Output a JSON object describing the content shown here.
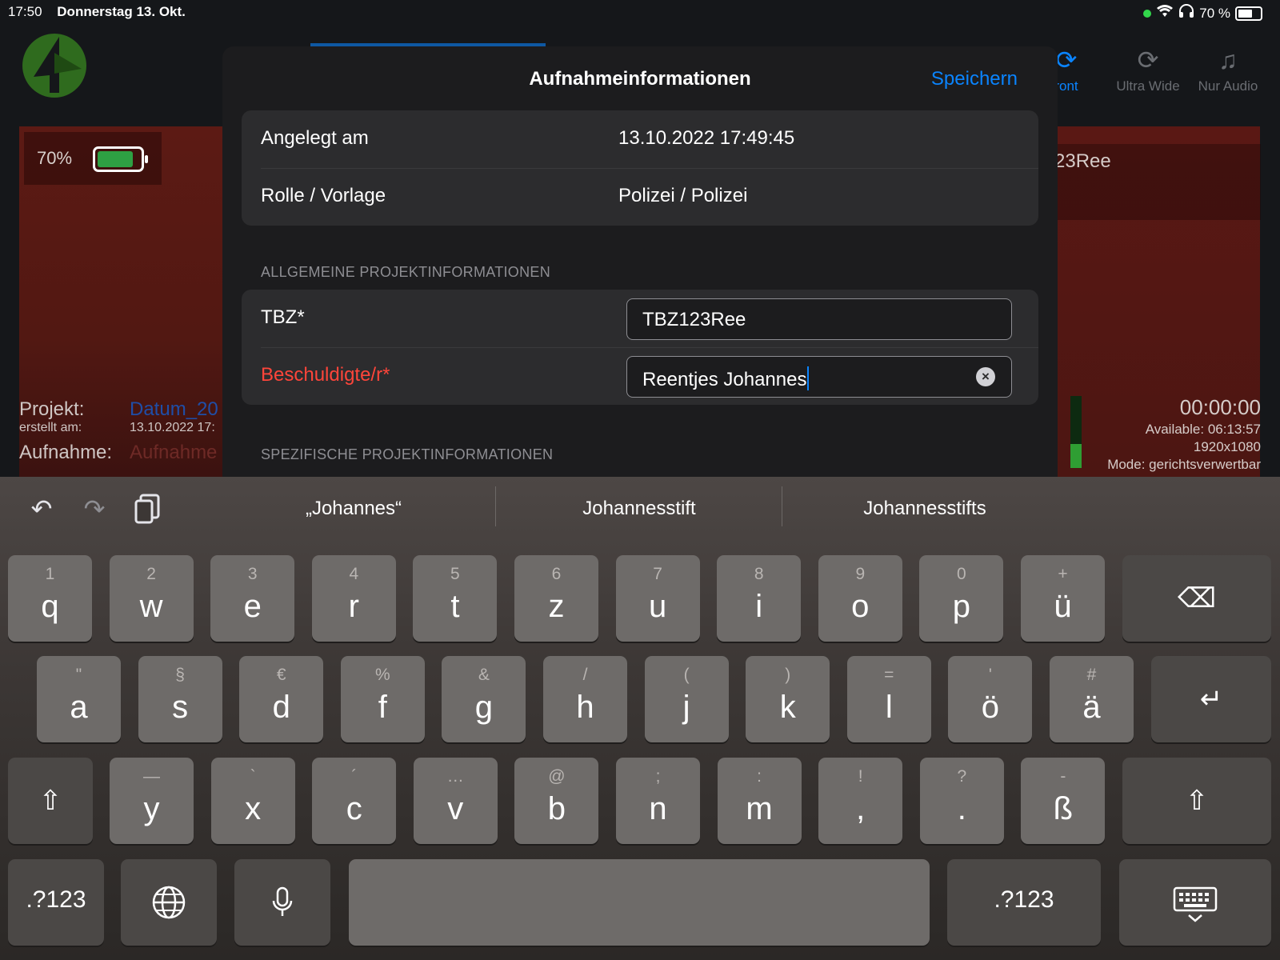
{
  "status_bar": {
    "time": "17:50",
    "date": "Donnerstag 13. Okt.",
    "battery": "70 %"
  },
  "background": {
    "camera_modes": [
      {
        "icon": "camera-rotate-icon",
        "label": "ront"
      },
      {
        "icon": "camera-rotate-icon",
        "label": "Ultra Wide"
      },
      {
        "icon": "microphone-wave-icon",
        "label": "Nur Audio"
      }
    ],
    "battery_percent_label": "70%",
    "battery_level": 0.7,
    "project": {
      "project_label": "Projekt:",
      "project_value": "Datum_20",
      "created_label": "erstellt am:",
      "created_value": "13.10.2022 17:",
      "recording_label": "Aufnahme:",
      "recording_value": "Aufnahme"
    },
    "tbz_preview": "23Ree",
    "stats": {
      "timer": "00:00:00",
      "available": "Available: 06:13:57",
      "resolution": "1920x1080",
      "mode": "Mode: gerichtsverwertbar"
    }
  },
  "sheet": {
    "title": "Aufnahmeinformationen",
    "save_label": "Speichern",
    "info_rows": [
      {
        "label": "Angelegt am",
        "value": "13.10.2022 17:49:45"
      },
      {
        "label": "Rolle / Vorlage",
        "value": "Polizei / Polizei"
      }
    ],
    "general_section": "ALLGEMEINE PROJEKTINFORMATIONEN",
    "fields": [
      {
        "label": "TBZ*",
        "value": "TBZ123Ree"
      },
      {
        "label": "Beschuldigte/r*",
        "value": "Reentjes Johannes"
      }
    ],
    "specific_section": "SPEZIFISCHE PROJEKTINFORMATIONEN"
  },
  "keyboard": {
    "suggestions": [
      "„Johannes“",
      "Johannesstift",
      "Johannesstifts"
    ],
    "row1": [
      {
        "alt": "1",
        "key": "q"
      },
      {
        "alt": "2",
        "key": "w"
      },
      {
        "alt": "3",
        "key": "e"
      },
      {
        "alt": "4",
        "key": "r"
      },
      {
        "alt": "5",
        "key": "t"
      },
      {
        "alt": "6",
        "key": "z"
      },
      {
        "alt": "7",
        "key": "u"
      },
      {
        "alt": "8",
        "key": "i"
      },
      {
        "alt": "9",
        "key": "o"
      },
      {
        "alt": "0",
        "key": "p"
      },
      {
        "alt": "+",
        "key": "ü"
      }
    ],
    "row2": [
      {
        "alt": "\"",
        "key": "a"
      },
      {
        "alt": "§",
        "key": "s"
      },
      {
        "alt": "€",
        "key": "d"
      },
      {
        "alt": "%",
        "key": "f"
      },
      {
        "alt": "&",
        "key": "g"
      },
      {
        "alt": "/",
        "key": "h"
      },
      {
        "alt": "(",
        "key": "j"
      },
      {
        "alt": ")",
        "key": "k"
      },
      {
        "alt": "=",
        "key": "l"
      },
      {
        "alt": "'",
        "key": "ö"
      },
      {
        "alt": "#",
        "key": "ä"
      }
    ],
    "row3": [
      {
        "alt": "—",
        "key": "y"
      },
      {
        "alt": "`",
        "key": "x"
      },
      {
        "alt": "´",
        "key": "c"
      },
      {
        "alt": "…",
        "key": "v"
      },
      {
        "alt": "@",
        "key": "b"
      },
      {
        "alt": ";",
        "key": "n"
      },
      {
        "alt": ":",
        "key": "m"
      },
      {
        "alt": "!",
        "key": ","
      },
      {
        "alt": "?",
        "key": "."
      },
      {
        "alt": "-",
        "key": "ß"
      }
    ],
    "numbers_label": ".?123",
    "space_label": ""
  }
}
